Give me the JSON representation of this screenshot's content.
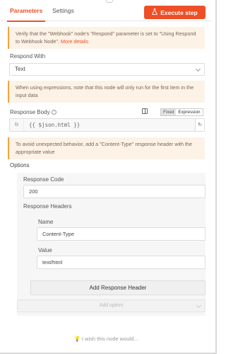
{
  "tabs": {
    "parameters": "Parameters",
    "settings": "Settings"
  },
  "execute_label": "Execute step",
  "notice_respond": {
    "text": "Verify that the \"Webhook\" node's \"Respond\" parameter is set to \"Using Respond to Webhook Node\".",
    "link": "More details"
  },
  "respond_with": {
    "label": "Respond With",
    "value": "Text"
  },
  "notice_expr": "When using expressions, note that this node will only run for the first item in the input data",
  "response_body": {
    "label": "Response Body",
    "value": "{{ $json.html }}",
    "mode_fixed": "Fixed",
    "mode_expression": "Expression"
  },
  "notice_header": "To avoid unexpected behavior, add a \"Content-Type\" response header with the appropriate value",
  "options": {
    "label": "Options",
    "response_code_label": "Response Code",
    "response_code_value": "200",
    "response_headers_label": "Response Headers",
    "name_label": "Name",
    "name_value": "Content-Type",
    "value_label": "Value",
    "value_value": "text/html",
    "add_header": "Add Response Header",
    "add_option": "Add option"
  },
  "footer": "I wish this node would..."
}
